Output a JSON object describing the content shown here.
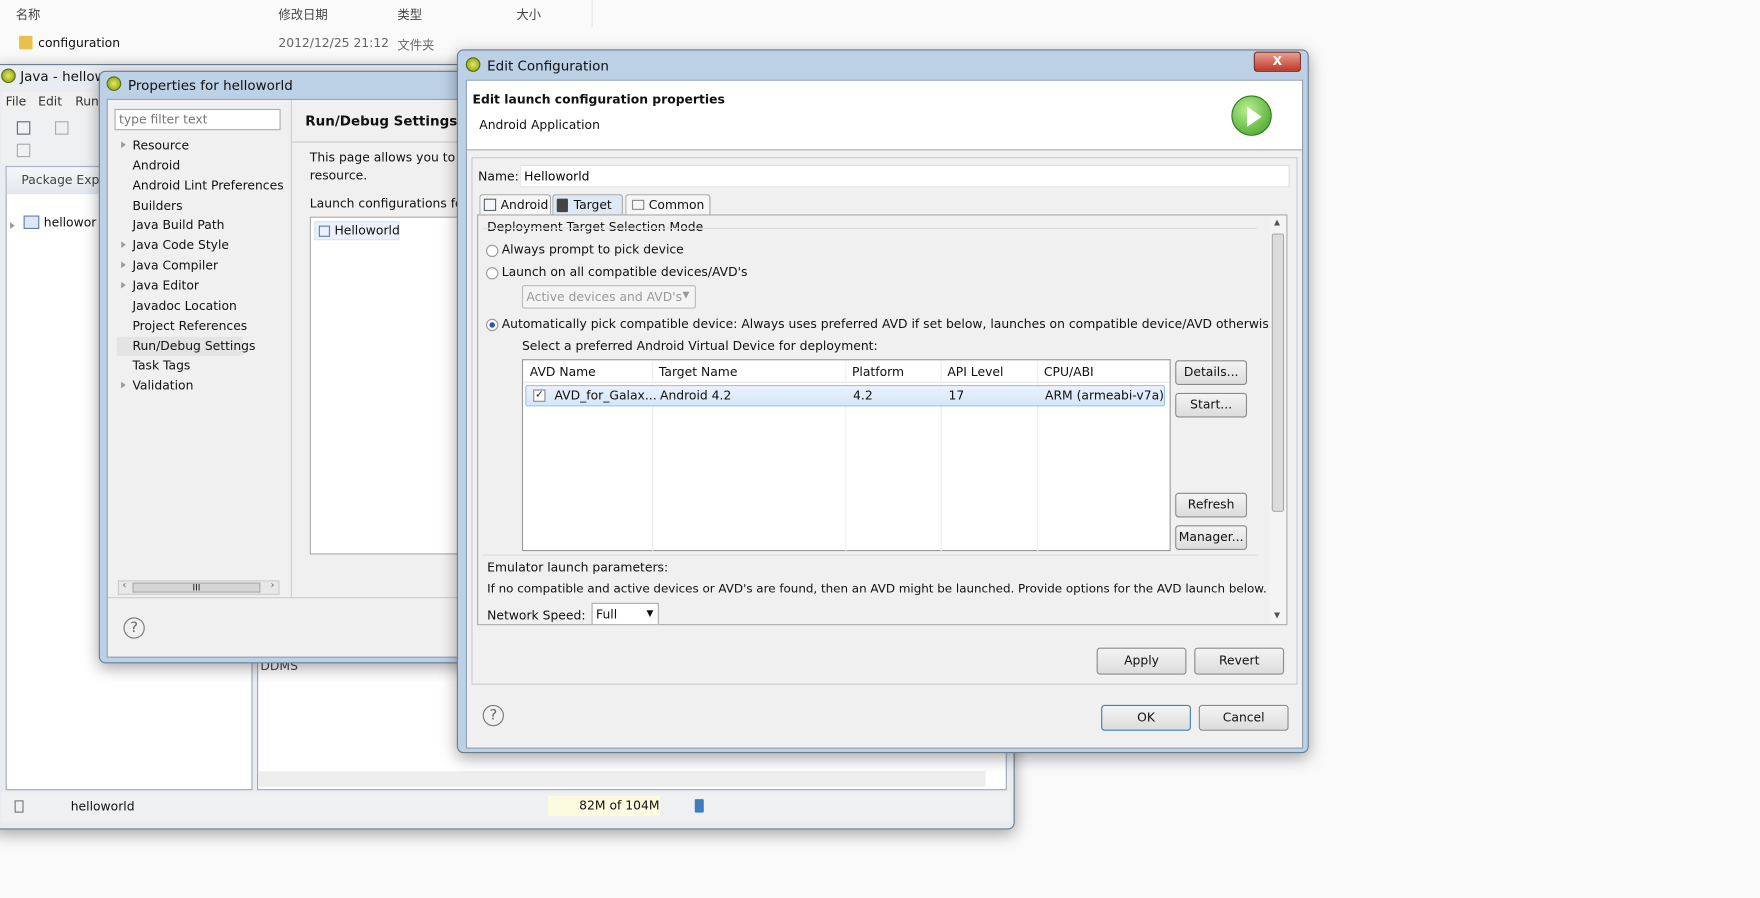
{
  "explorer": {
    "columns": [
      "名称",
      "修改日期",
      "类型",
      "大小"
    ],
    "rows": [
      {
        "name": "configuration",
        "date": "2012/12/25 21:12",
        "type": "文件夹"
      }
    ]
  },
  "eclipse": {
    "title": "Java - hellowo",
    "menu": [
      "File",
      "Edit",
      "Run"
    ],
    "package_explorer_tab": "Package Exp",
    "tree_item": "hellowor",
    "ddms_label": "DDMS",
    "status_project": "helloworld",
    "memory": "82M of 104M"
  },
  "properties": {
    "title": "Properties for helloworld",
    "filter_placeholder": "type filter text",
    "tree": [
      {
        "label": "Resource",
        "expandable": true
      },
      {
        "label": "Android",
        "expandable": false
      },
      {
        "label": "Android Lint Preferences",
        "expandable": false
      },
      {
        "label": "Builders",
        "expandable": false
      },
      {
        "label": "Java Build Path",
        "expandable": false
      },
      {
        "label": "Java Code Style",
        "expandable": true
      },
      {
        "label": "Java Compiler",
        "expandable": true
      },
      {
        "label": "Java Editor",
        "expandable": true
      },
      {
        "label": "Javadoc Location",
        "expandable": false
      },
      {
        "label": "Project References",
        "expandable": false
      },
      {
        "label": "Run/Debug Settings",
        "expandable": false,
        "selected": true
      },
      {
        "label": "Task Tags",
        "expandable": false
      },
      {
        "label": "Validation",
        "expandable": true
      }
    ],
    "page_title": "Run/Debug Settings",
    "desc_line1": "This page allows you to m",
    "desc_line2": "resource.",
    "launch_label": "Launch configurations for",
    "launch_item": "Helloworld",
    "scroll_thumb": "III"
  },
  "edit": {
    "title": "Edit Configuration",
    "close": "X",
    "header_title": "Edit launch configuration properties",
    "header_subtitle": "Android Application",
    "name_label": "Name:",
    "name_value": "Helloworld",
    "tabs": [
      {
        "label": "Android"
      },
      {
        "label": "Target",
        "selected": true
      },
      {
        "label": "Common"
      }
    ],
    "group_title": "Deployment Target Selection Mode",
    "radio_prompt": "Always prompt to pick device",
    "radio_all": "Launch on all compatible devices/AVD's",
    "active_combo": "Active devices and AVD's",
    "radio_auto": "Automatically pick compatible device: Always uses preferred AVD if set below, launches on compatible device/AVD otherwise.",
    "select_label": "Select a preferred Android Virtual Device for deployment:",
    "table": {
      "headers": [
        "AVD Name",
        "Target Name",
        "Platform",
        "API Level",
        "CPU/ABI"
      ],
      "rows": [
        {
          "checked": true,
          "cells": [
            "AVD_for_Galax...",
            "Android 4.2",
            "4.2",
            "17",
            "ARM (armeabi-v7a)"
          ]
        }
      ]
    },
    "buttons": {
      "details": "Details...",
      "start": "Start...",
      "refresh": "Refresh",
      "manager": "Manager...",
      "apply": "Apply",
      "revert": "Revert",
      "ok": "OK",
      "cancel": "Cancel"
    },
    "emulator_group": "Emulator launch parameters:",
    "emulator_text": "If no compatible and active devices or AVD's are found, then an AVD might be launched. Provide options for the AVD launch below.",
    "network_label": "Network Speed:",
    "network_value": "Full"
  }
}
